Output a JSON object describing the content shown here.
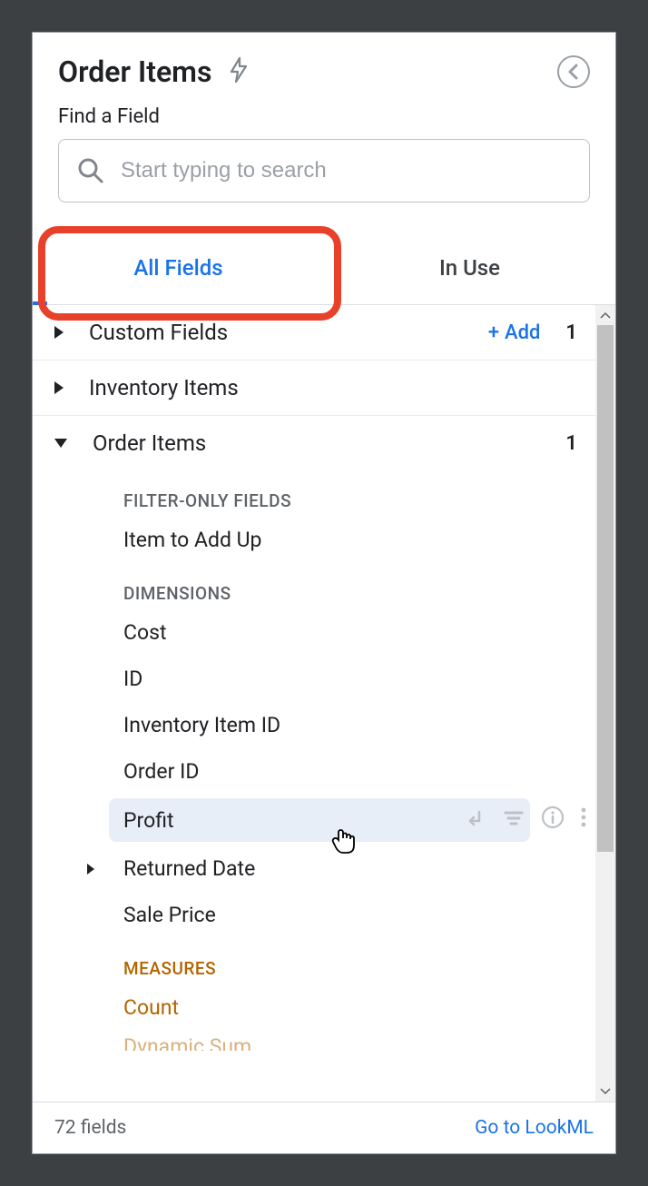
{
  "header": {
    "title": "Order Items"
  },
  "search": {
    "label": "Find a Field",
    "placeholder": "Start typing to search"
  },
  "tabs": {
    "all_fields": "All Fields",
    "in_use": "In Use"
  },
  "groups": {
    "custom_fields": {
      "label": "Custom Fields",
      "add": "Add",
      "count": "1"
    },
    "inventory_items": {
      "label": "Inventory Items"
    },
    "order_items": {
      "label": "Order Items",
      "count": "1"
    }
  },
  "sections": {
    "filter_only": "FILTER-ONLY FIELDS",
    "dimensions": "DIMENSIONS",
    "measures": "MEASURES"
  },
  "fields": {
    "item_to_add_up": "Item to Add Up",
    "cost": "Cost",
    "id": "ID",
    "inventory_item_id": "Inventory Item ID",
    "order_id": "Order ID",
    "profit": "Profit",
    "returned_date": "Returned Date",
    "sale_price": "Sale Price",
    "count": "Count",
    "dynamic_sum": "Dynamic Sum"
  },
  "footer": {
    "count": "72 fields",
    "link": "Go to LookML"
  }
}
